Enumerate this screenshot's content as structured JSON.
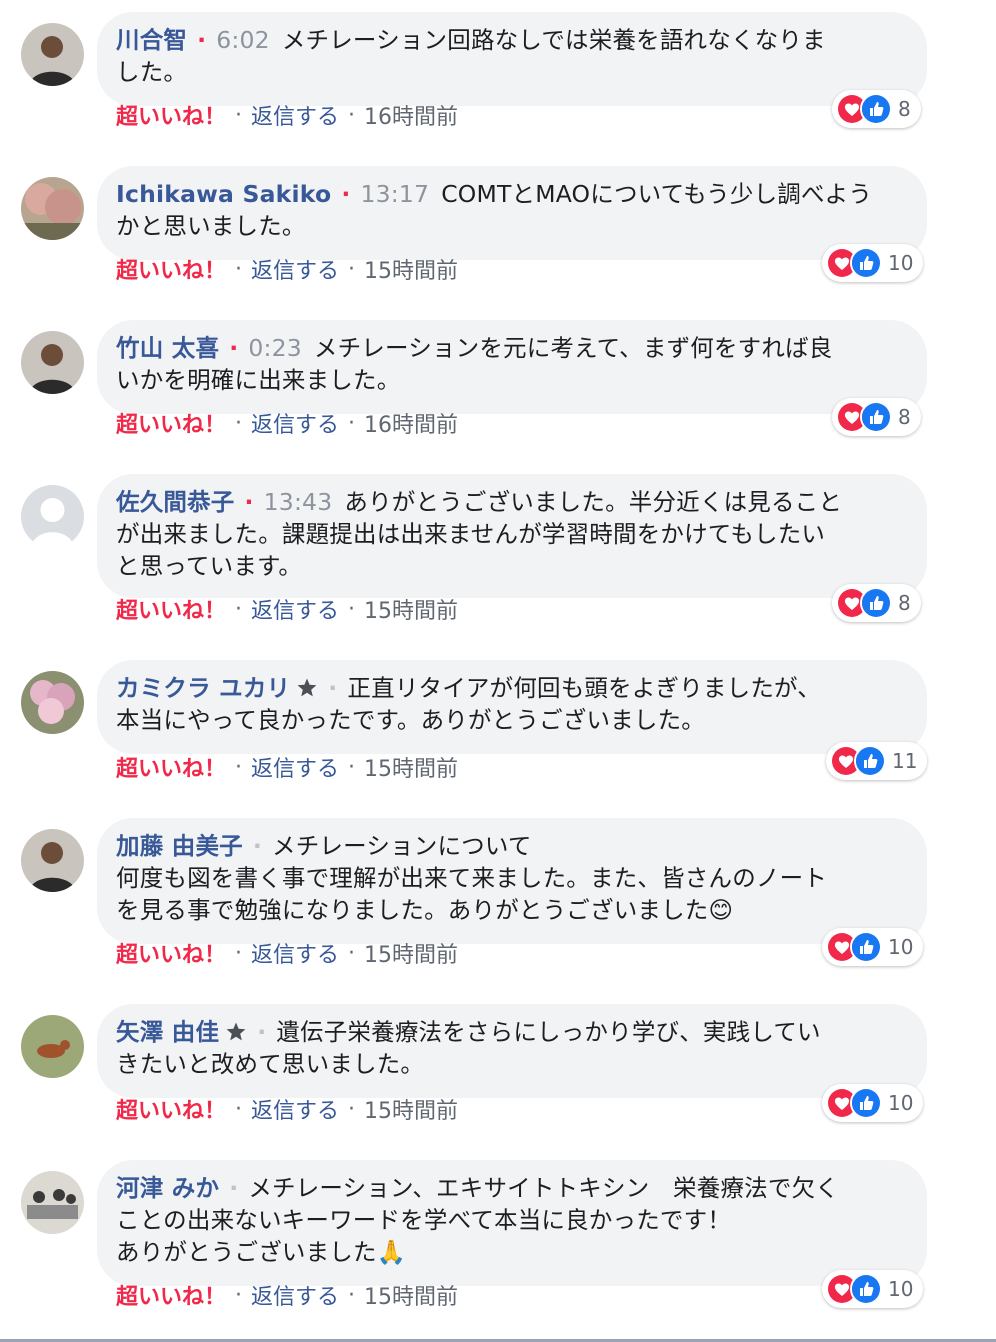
{
  "colors": {
    "author": "#385898",
    "super_like": "#f02849",
    "bubble": "#f2f3f5",
    "meta": "#606770"
  },
  "comments": [
    {
      "author": "川合智",
      "badge": false,
      "time": "6:02",
      "text": "メチレーションを回路なしでは栄養を語れなくなりました。",
      "text_lines": [
        "メチレーション回路なしでは栄養を語れなくなりま",
        "した。"
      ],
      "reactions": {
        "count": "8",
        "icons": [
          "love-icon",
          "like-icon"
        ]
      },
      "super_like": "超いいね！",
      "reply": "返信する",
      "ago": "16時間前",
      "avatar": "person-photo"
    },
    {
      "author": "Ichikawa Sakiko",
      "badge": false,
      "time": "13:17",
      "text_lines": [
        "COMTとMAOについてもう少し調べよう",
        "かと思いました。"
      ],
      "reactions": {
        "count": "10",
        "icons": [
          "love-icon",
          "like-icon"
        ]
      },
      "super_like": "超いいね！",
      "reply": "返信する",
      "ago": "15時間前",
      "avatar": "tree-photo"
    },
    {
      "author": "竹山 太喜",
      "badge": false,
      "time": "0:23",
      "text_lines": [
        "メチレーションを元に考えて、まず何をすれば良",
        "いかを明確に出来ました。"
      ],
      "reactions": {
        "count": "8",
        "icons": [
          "love-icon",
          "like-icon"
        ]
      },
      "super_like": "超いいね！",
      "reply": "返信する",
      "ago": "16時間前",
      "avatar": "person-photo"
    },
    {
      "author": "佐久間恭子",
      "badge": false,
      "time": "13:43",
      "text_lines": [
        "ありがとうございました。半分近くは見ること",
        "が出来ました。課題提出は出来ませんが学習時間をかけてもしたい",
        "と思っています。"
      ],
      "reactions": {
        "count": "8",
        "icons": [
          "love-icon",
          "like-icon"
        ]
      },
      "super_like": "超いいね！",
      "reply": "返信する",
      "ago": "15時間前",
      "avatar": "default-silhouette"
    },
    {
      "author": "カミクラ ユカリ",
      "badge": true,
      "time": "",
      "text_lines": [
        "正直リタイアが何回も頭をよぎりましたが、",
        "本当にやって良かったです。ありがとうございました。"
      ],
      "reactions": {
        "count": "11",
        "icons": [
          "love-icon",
          "like-icon"
        ]
      },
      "super_like": "超いいね！",
      "reply": "返信する",
      "ago": "15時間前",
      "avatar": "flower-photo"
    },
    {
      "author": "加藤 由美子",
      "badge": false,
      "time": "",
      "text_lines": [
        "メチレーションについて",
        "何度も図を書く事で理解が出来て来ました。また、皆さんのノート",
        "を見る事で勉強になりました。ありがとうございました😊"
      ],
      "reactions": {
        "count": "10",
        "icons": [
          "love-icon",
          "like-icon"
        ]
      },
      "super_like": "超いいね！",
      "reply": "返信する",
      "ago": "15時間前",
      "avatar": "person-photo"
    },
    {
      "author": "矢澤 由佳",
      "badge": true,
      "time": "",
      "text_lines": [
        "遺伝子栄養療法をさらにしっかり学び、実践してい",
        "きたいと改めて思いました。"
      ],
      "reactions": {
        "count": "10",
        "icons": [
          "love-icon",
          "like-icon"
        ]
      },
      "super_like": "超いいね！",
      "reply": "返信する",
      "ago": "15時間前",
      "avatar": "dog-photo"
    },
    {
      "author": "河津 みか",
      "badge": false,
      "time": "",
      "text_lines": [
        "メチレーション、エキサイトトキシン　栄養療法で欠く",
        "ことの出来ないキーワードを学べて本当に良かったです！",
        "ありがとうございました🙏"
      ],
      "reactions": {
        "count": "10",
        "icons": [
          "love-icon",
          "like-icon"
        ]
      },
      "super_like": "超いいね！",
      "reply": "返信する",
      "ago": "15時間前",
      "avatar": "classroom-photo"
    }
  ]
}
